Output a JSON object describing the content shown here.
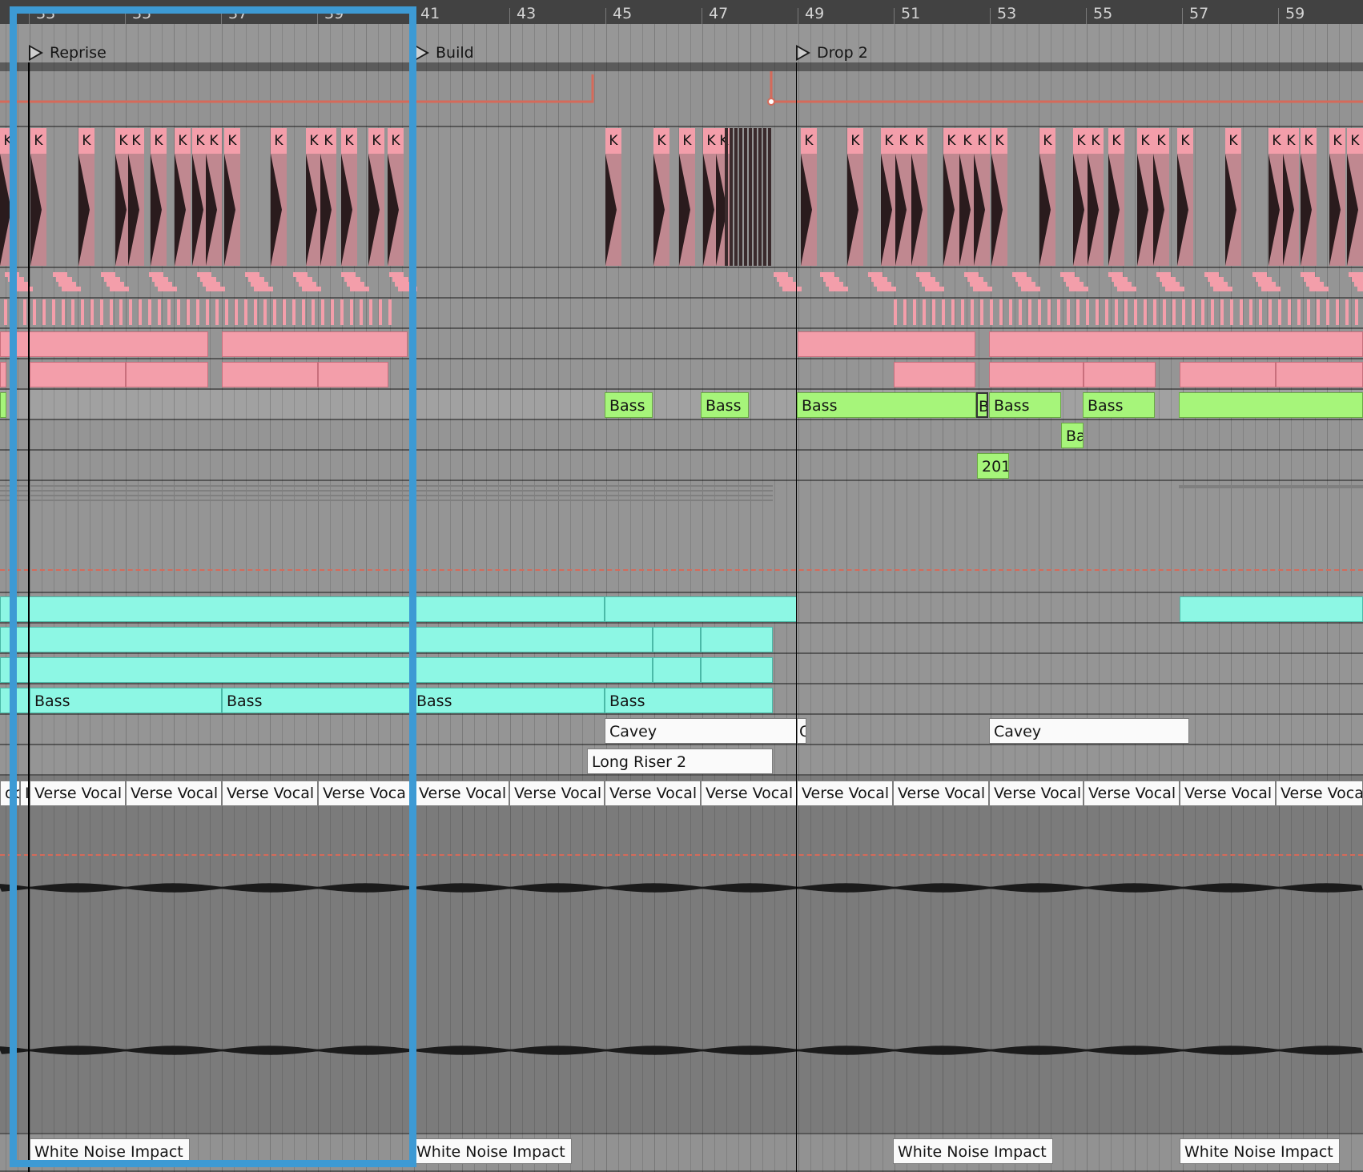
{
  "ruler": {
    "bars": [
      "33",
      "35",
      "37",
      "39",
      "41",
      "43",
      "45",
      "47",
      "49",
      "51",
      "53",
      "55",
      "57",
      "59"
    ]
  },
  "locators": [
    {
      "label": "Reprise"
    },
    {
      "label": "Build"
    },
    {
      "label": "Drop 2"
    }
  ],
  "kick_label": "K",
  "bass_green": [
    {
      "label": "Bass"
    },
    {
      "label": "Bass"
    },
    {
      "label": "Bass"
    },
    {
      "label": "B"
    },
    {
      "label": "Bass"
    },
    {
      "label": "Bass"
    },
    {
      "label": "Ba"
    },
    {
      "label": "201"
    }
  ],
  "bass_cyan": [
    {
      "label": "Bass"
    },
    {
      "label": "Bass"
    },
    {
      "label": "Bass"
    },
    {
      "label": "Bass"
    }
  ],
  "cavey": [
    {
      "label": "Cavey"
    },
    {
      "label": "C"
    },
    {
      "label": "Cavey"
    }
  ],
  "riser": {
    "label": "Long Riser 2"
  },
  "vocal_label": "Verse Vocal",
  "vocal_partial_a": "oc",
  "vocal_partial_b": "I",
  "vocal_partial_c": "Verse Voca",
  "impacts": [
    {
      "label": "White Noise Impact"
    },
    {
      "label": "White Noise Impact"
    },
    {
      "label": "White Noise Impact"
    },
    {
      "label": "White Noise Impact"
    }
  ],
  "colors": {
    "selection": "#3d9ad4",
    "automation": "#d56a5a",
    "midi_green": "#a6f57a",
    "midi_cyan": "#8df7e4",
    "drum_pink": "#f39eaa"
  }
}
